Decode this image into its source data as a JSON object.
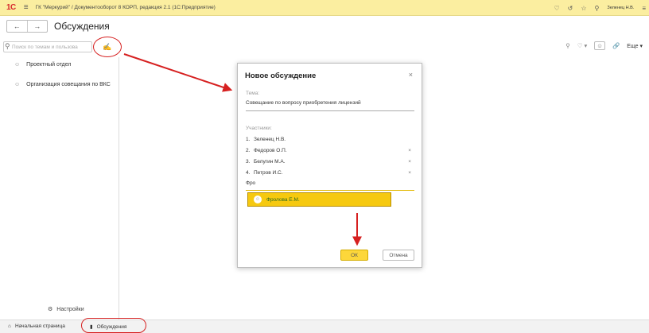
{
  "titlebar": {
    "logo": "1С",
    "title": "ГК \"Меркурий\" / Документооборот 8 КОРП, редакция 2.1  (1С:Предприятие)",
    "user": "Зеленец Н.В."
  },
  "header": {
    "title": "Обсуждения"
  },
  "search": {
    "placeholder": "Поиск по темам и пользова"
  },
  "sidebar": {
    "items": [
      {
        "label": "Проектный отдел"
      },
      {
        "label": "Организация совещания по ВКС"
      }
    ],
    "settings_label": "Настройки"
  },
  "toolbar": {
    "more_label": "Еще"
  },
  "dialog": {
    "title": "Новое обсуждение",
    "topic_label": "Тема:",
    "topic_value": "Совещание по вопросу приобретения лицензий",
    "participants_label": "Участники:",
    "participants": [
      {
        "num": "1.",
        "name": "Зеленец Н.В."
      },
      {
        "num": "2.",
        "name": "Федоров О.П."
      },
      {
        "num": "3.",
        "name": "Белугин М.А."
      },
      {
        "num": "4.",
        "name": "Петров И.С."
      }
    ],
    "typed_value": "Фро",
    "suggestion": "Фролова Е.М.",
    "ok_label": "ОК",
    "cancel_label": "Отмена"
  },
  "bottom": {
    "home_label": "Начальная страница",
    "discussions_label": "Обсуждения"
  },
  "colors": {
    "titlebar_bg": "#fbeea0",
    "accent_yellow": "#f6c910",
    "annotation_red": "#d62020"
  }
}
